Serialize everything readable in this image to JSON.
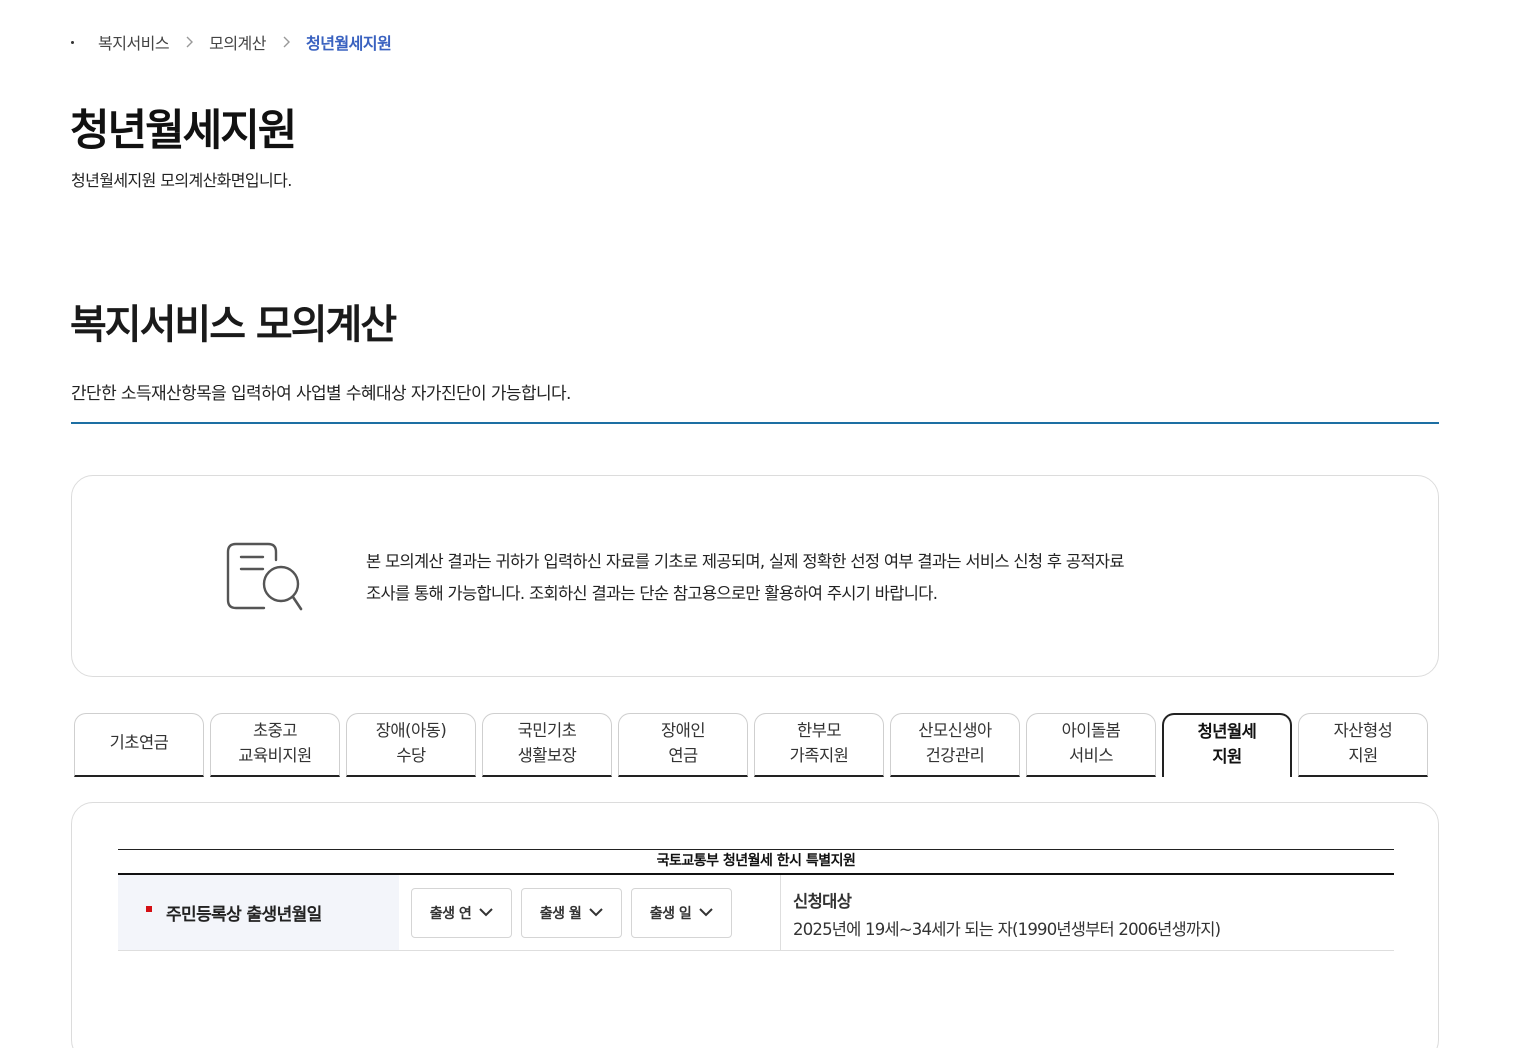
{
  "breadcrumb": {
    "items": [
      "복지서비스",
      "모의계산"
    ],
    "current": "청년월세지원"
  },
  "page": {
    "title": "청년월세지원",
    "subtitle": "청년월세지원 모의계산화면입니다."
  },
  "section": {
    "title": "복지서비스 모의계산",
    "description": "간단한 소득재산항목을 입력하여 사업별 수혜대상 자가진단이 가능합니다."
  },
  "notice": {
    "icon": "document-search-icon",
    "line1": "본 모의계산 결과는 귀하가 입력하신 자료를 기초로 제공되며, 실제 정확한 선정 여부 결과는 서비스 신청 후 공적자료",
    "line2": "조사를 통해 가능합니다. 조회하신 결과는 단순 참고용으로만 활용하여 주시기 바랍니다."
  },
  "tabs": [
    {
      "line1": "기초연금",
      "line2": ""
    },
    {
      "line1": "초중고",
      "line2": "교육비지원"
    },
    {
      "line1": "장애(아동)",
      "line2": "수당"
    },
    {
      "line1": "국민기초",
      "line2": "생활보장"
    },
    {
      "line1": "장애인",
      "line2": "연금"
    },
    {
      "line1": "한부모",
      "line2": "가족지원"
    },
    {
      "line1": "산모신생아",
      "line2": "건강관리"
    },
    {
      "line1": "아이돌봄",
      "line2": "서비스"
    },
    {
      "line1": "청년월세",
      "line2": "지원"
    },
    {
      "line1": "자산형성",
      "line2": "지원"
    }
  ],
  "active_tab_index": 8,
  "calc": {
    "caption": "국토교통부 청년월세 한시 특별지원",
    "row": {
      "label": "주민등록상 출생년월일",
      "selects": {
        "year": "출생 연",
        "month": "출생 월",
        "day": "출생 일"
      },
      "info_title": "신청대상",
      "info_body": "2025년에 19세~34세가 되는 자(1990년생부터 2006년생까지)"
    }
  },
  "colors": {
    "accent_blue": "#3a62c0",
    "divider_blue": "#1d6fa3",
    "required_red": "#d40f14"
  }
}
